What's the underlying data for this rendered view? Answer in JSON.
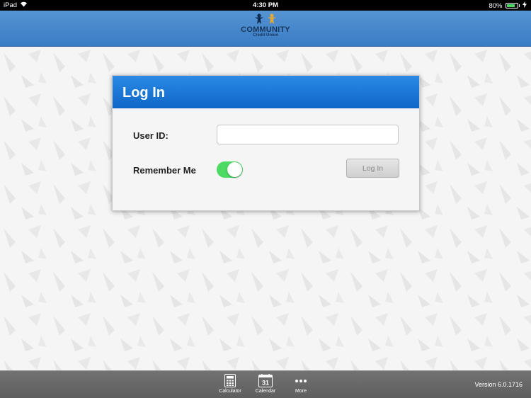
{
  "status_bar": {
    "device": "iPad",
    "time": "4:30 PM",
    "battery_percent": "80%",
    "battery_level": 0.8
  },
  "header": {
    "logo_title": "COMMUNITY",
    "logo_subtitle": "Credit Union"
  },
  "login": {
    "title": "Log In",
    "user_id_label": "User ID:",
    "user_id_value": "",
    "remember_label": "Remember Me",
    "remember_on": true,
    "login_button": "Log In"
  },
  "toolbar": {
    "items": [
      {
        "label": "Calculator",
        "icon": "calculator-icon"
      },
      {
        "label": "Calendar",
        "icon": "calendar-icon",
        "badge": "31"
      },
      {
        "label": "More",
        "icon": "more-icon"
      }
    ],
    "version": "Version 6.0.1716"
  },
  "colors": {
    "header": "#4a8bd0",
    "login_header": "#1a77d8",
    "toggle_on": "#4cd964",
    "toolbar": "#686868"
  }
}
